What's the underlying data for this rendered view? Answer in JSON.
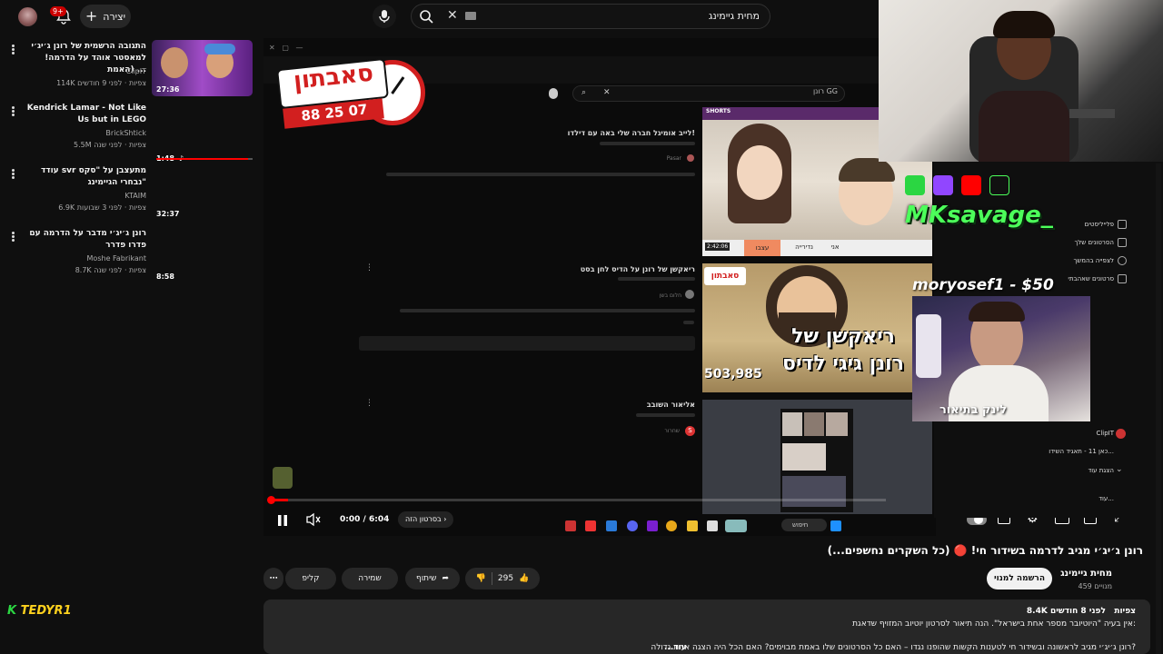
{
  "topbar": {
    "create_label": "יצירה",
    "notif_count": "9+",
    "search_value": "מחית גיימינג"
  },
  "sidebar_list": [
    {
      "title": "התגובה הרשמית של רונן ג׳יג׳י למאסטר אוהד על הדרמה! (האמת ...",
      "channel": "ClipIT",
      "meta": "114K צפיות · לפני 9 חודשים",
      "duration": "27:36"
    },
    {
      "title": "Kendrick Lamar - Not Like Us but in LEGO",
      "channel": "BrickShtick",
      "meta": "5.5M צפיות · לפני שנה",
      "duration": "1:48"
    },
    {
      "title": "עודד svr מתעצבן על \"סקס נבחרי הגיימינג\"",
      "channel": "KTAIM",
      "meta": "6.9K צפיות · לפני 3 שבועות",
      "duration": "32:37"
    },
    {
      "title": "רונן ג׳יג׳י מדבר על הדרמה עם פדרו פדרר",
      "channel": "Moshe Fabrikant",
      "meta": "8.7K צפיות · לפני שנה",
      "duration": "8:58"
    }
  ],
  "video": {
    "inner_logo_text": "סאבתון",
    "inner_logo_number": "88 25 07",
    "inner_search": "רונן GG",
    "inner_results": [
      {
        "title": "לייב אומיגל חברה שלי באה עם דילדו!",
        "channel": "Pasar"
      },
      {
        "title": "ריאקשן של רונן על הדיס לחן בסט",
        "channel": "חלום בשן"
      },
      {
        "title": "אליאור השובב",
        "channel": "שחרור"
      }
    ],
    "thumb1_tags": [
      "אני",
      "נדירייה",
      "עצבו"
    ],
    "thumb1_duration": "2:42:06",
    "thumb1_badge": "SHORTS",
    "thumb2_caption_1": "ריאקשן של",
    "thumb2_caption_2": "רונן גיגי לדיס",
    "thumb2_views": "503,985",
    "thumb2_logo": "סאבתון",
    "time_current": "0:00",
    "time_sep": "/",
    "time_total": "6:04",
    "chapter_label": "בסרטון הזה",
    "progress": 0.03,
    "taskbar_search": "חיפוש"
  },
  "overlay": {
    "streamer_tag": "MKsavage_",
    "donation": "moryosef1 - $50",
    "link_label": "לינק בתיאור",
    "chat_user": "TEDYR1"
  },
  "right_panel": {
    "items": [
      "פלייליסטים",
      "הסרטונים שלך",
      "לצפייה בהמשך",
      "סרטונים שאהבתי"
    ],
    "channel_item": "ClipIT",
    "channel_sub": "כאן 11 - תאגיד השידו...",
    "show_more": "הצגת עוד",
    "more_label": "עוד..."
  },
  "below": {
    "title": "רונן ג׳יג׳י מגיב לדרמה בשידור חי! 🔴 (כל השקרים נחשפים...)",
    "channel": "מחית גיימינג",
    "subs": "459 מנויים",
    "subscribe": "הרשמה למנוי",
    "likes": "295",
    "share": "שיתוף",
    "save": "שמירה",
    "clip": "קליפ",
    "desc_views": "8.4K צפיות",
    "desc_date": "לפני 8 חודשים",
    "desc_line1": "אין בעיה \"היוטיובר מספר אחת בישראל\". הנה תיאור לסרטון יוטיוב המזויף שדאגת:",
    "desc_line2": "רונן ג׳יג׳י מגיב לראשונה ובשידור חי לטענות הקשות שהופנו נגדו – האם כל הסרטונים שלו באמת מבוימים? האם הכל היה הצגה אחת גדולה?",
    "desc_more": "...עוד"
  },
  "colors": {
    "accent": "#ff0000",
    "streamer_green": "#4cff5a",
    "chat_yellow": "#ffd21e"
  }
}
